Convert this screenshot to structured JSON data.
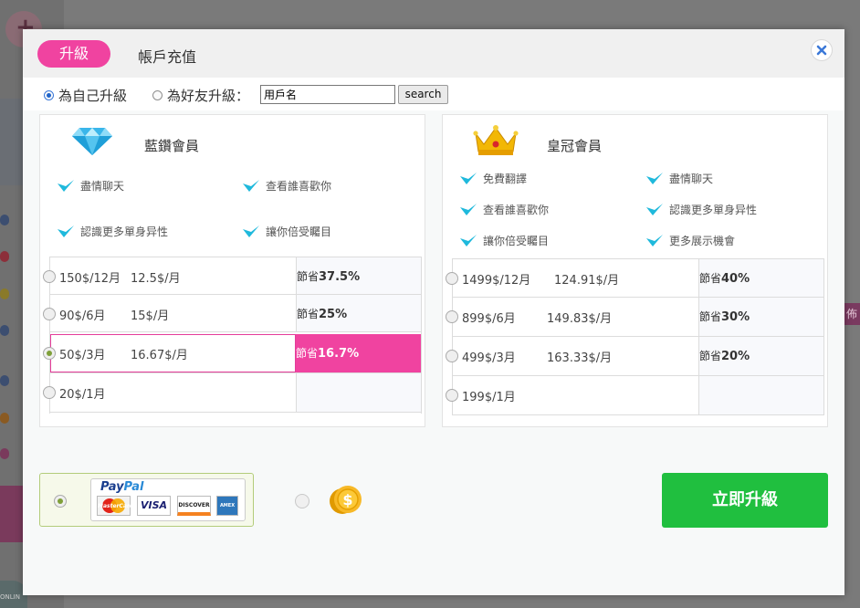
{
  "tabs": {
    "upgrade": "升級",
    "recharge": "帳戶充值"
  },
  "target": {
    "self_label": "為自己升級",
    "friend_label": "為好友升級：",
    "username_placeholder": "用戶名",
    "username_value": "用戶名",
    "search_label": "search"
  },
  "blue_plan": {
    "title": "藍鑽會員",
    "features": [
      "盡情聊天",
      "查看誰喜歡你",
      "認識更多單身异性",
      "讓你倍受矚目"
    ],
    "rows": [
      {
        "total": "150$/12月",
        "monthly": "12.5$/月",
        "save_prefix": "節省",
        "save_value": "37.5%"
      },
      {
        "total": "90$/6月",
        "monthly": "15$/月",
        "save_prefix": "節省",
        "save_value": "25%"
      },
      {
        "total": "50$/3月",
        "monthly": "16.67$/月",
        "save_prefix": "節省",
        "save_value": "16.7%"
      },
      {
        "total": "20$/1月",
        "monthly": "",
        "save_prefix": "",
        "save_value": ""
      }
    ],
    "selected_row": 2
  },
  "crown_plan": {
    "title": "皇冠會員",
    "features": [
      "免費翻譯",
      "盡情聊天",
      "查看誰喜歡你",
      "認識更多單身异性",
      "讓你倍受矚目",
      "更多展示機會"
    ],
    "rows": [
      {
        "total": "1499$/12月",
        "monthly": "124.91$/月",
        "save_prefix": "節省",
        "save_value": "40%"
      },
      {
        "total": "899$/6月",
        "monthly": "149.83$/月",
        "save_prefix": "節省",
        "save_value": "30%"
      },
      {
        "total": "499$/3月",
        "monthly": "163.33$/月",
        "save_prefix": "節省",
        "save_value": "20%"
      },
      {
        "total": "199$/1月",
        "monthly": "",
        "save_prefix": "",
        "save_value": ""
      }
    ]
  },
  "payment": {
    "paypal_logo_a": "Pay",
    "paypal_logo_b": "Pal",
    "cards": [
      "MasterCard",
      "VISA",
      "DISCOVER",
      "AMEX"
    ],
    "selected": "paypal",
    "coin_symbol": "$"
  },
  "upgrade_button": "立即升級",
  "background": {
    "side_strip_text": "佈",
    "online_text": "ONLIN"
  },
  "colors": {
    "accent_pink": "#f043a0",
    "check_cyan": "#1fb9dc",
    "cta_green": "#20bf3f"
  }
}
